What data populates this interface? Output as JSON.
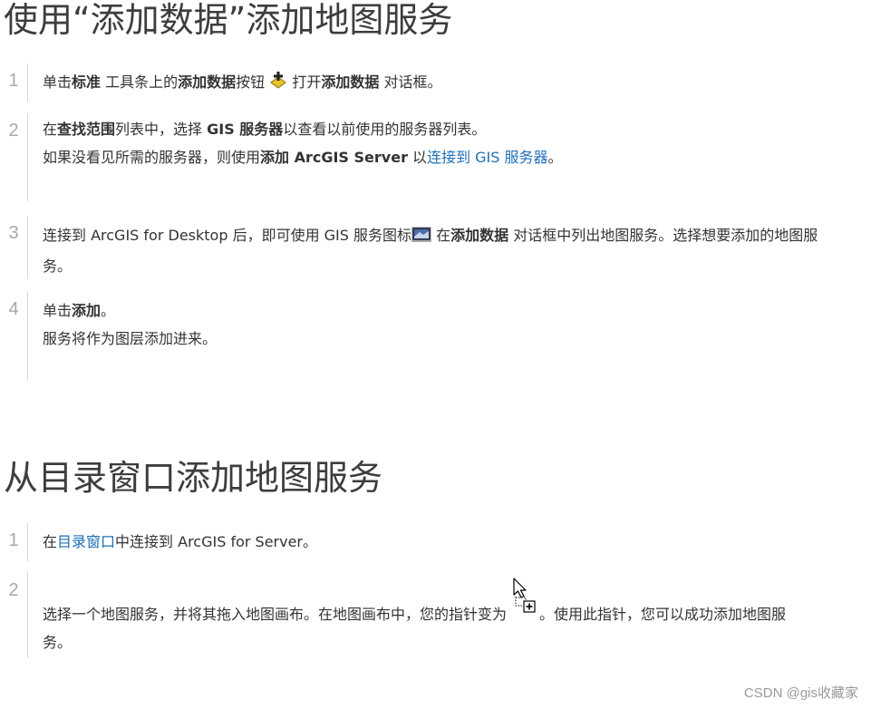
{
  "section1": {
    "title": "使用“添加数据”添加地图服务",
    "steps": [
      {
        "num": "1",
        "t1": "单击",
        "b1": "标准",
        "t2": " 工具条上的",
        "b2": "添加数据",
        "t3": "按钮",
        "icon": "add-data-icon",
        "t4": " 打开",
        "b3": "添加数据",
        "t5": " 对话框。"
      },
      {
        "num": "2",
        "line1_t1": "在",
        "line1_b1": "查找范围",
        "line1_t2": "列表中，选择 ",
        "line1_b2": "GIS 服务器",
        "line1_t3": "以查看以前使用的服务器列表。",
        "line2_t1": "如果没看见所需的服务器，则使用",
        "line2_b1": "添加 ArcGIS Server",
        "line2_t2": " 以",
        "line2_link": "连接到 GIS 服务器",
        "line2_t3": "。"
      },
      {
        "num": "3",
        "t1": "连接到 ArcGIS for Desktop 后，即可使用 GIS 服务图标",
        "icon": "gis-service-icon",
        "t2": " 在",
        "b1": "添加数据",
        "t3": " 对话框中列出地图服务。选择想要添加的地图服",
        "line2": "务。"
      },
      {
        "num": "4",
        "t1": "单击",
        "b1": "添加",
        "t2": "。",
        "line2": "服务将作为图层添加进来。"
      }
    ]
  },
  "section2": {
    "title": "从目录窗口添加地图服务",
    "steps": [
      {
        "num": "1",
        "t1": "在",
        "link": "目录窗口",
        "t2": "中连接到 ArcGIS for Server。"
      },
      {
        "num": "2",
        "t1": "选择一个地图服务，并将其拖入地图画布。在地图画布中，您的指针变为",
        "icon": "drag-add-cursor-icon",
        "t2": "。使用此指针，您可以成功添加地图服",
        "line2": "务。"
      }
    ]
  },
  "watermark": "CSDN @gis收藏家",
  "colors": {
    "link": "#1f6fb5",
    "text": "#333333",
    "number": "#a8a8a8"
  }
}
